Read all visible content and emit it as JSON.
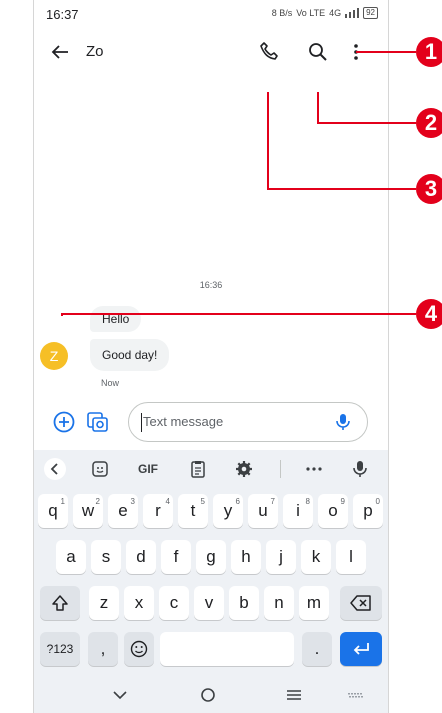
{
  "status_bar": {
    "time": "16:37",
    "net": "8 B/s",
    "volte": "Vo LTE",
    "signal": "4G",
    "battery": "92"
  },
  "app_bar": {
    "title": "Zo",
    "icons": [
      "back-arrow-icon",
      "phone-icon",
      "search-icon",
      "more-vert-icon"
    ]
  },
  "conversation": {
    "timestamp": "16:36",
    "contact_initial": "Z",
    "messages": [
      "Hello",
      "Good day!"
    ],
    "status": "Now"
  },
  "composer": {
    "placeholder": "Text message"
  },
  "keyboard": {
    "toolbar_gif": "GIF",
    "row1": [
      {
        "k": "q",
        "s": "1"
      },
      {
        "k": "w",
        "s": "2"
      },
      {
        "k": "e",
        "s": "3"
      },
      {
        "k": "r",
        "s": "4"
      },
      {
        "k": "t",
        "s": "5"
      },
      {
        "k": "y",
        "s": "6"
      },
      {
        "k": "u",
        "s": "7"
      },
      {
        "k": "i",
        "s": "8"
      },
      {
        "k": "o",
        "s": "9"
      },
      {
        "k": "p",
        "s": "0"
      }
    ],
    "row2": [
      "a",
      "s",
      "d",
      "f",
      "g",
      "h",
      "j",
      "k",
      "l"
    ],
    "row3": [
      "z",
      "x",
      "c",
      "v",
      "b",
      "n",
      "m"
    ],
    "symbols": "?123",
    "comma": ",",
    "period": "."
  },
  "callouts": [
    "1",
    "2",
    "3",
    "4"
  ],
  "colors": {
    "accent": "#1a73e8",
    "avatar": "#f6bf26",
    "callout": "#e3001b"
  }
}
